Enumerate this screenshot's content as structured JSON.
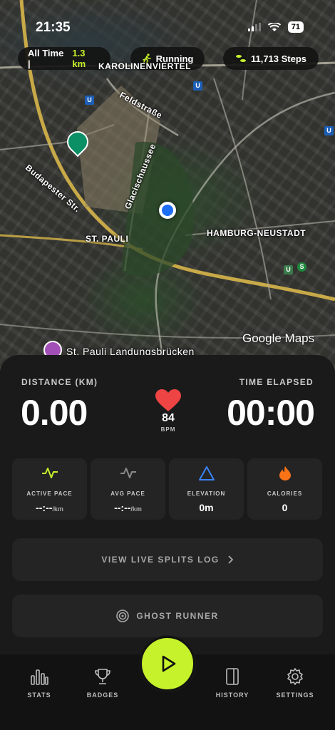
{
  "status_bar": {
    "time": "21:35",
    "battery": "71"
  },
  "top_pills": {
    "period_label": "All Time |",
    "period_distance": "1.3 km",
    "activity": "Running",
    "steps": "11,713 Steps"
  },
  "map": {
    "labels": {
      "karolinenviertel": "KAROLINENVIERTEL",
      "feldstrasse": "Feldstraße",
      "budapester": "Budapester Str.",
      "glacischaussee": "Glacischaussee",
      "st_pauli": "ST. PAULI",
      "hamburg_neustadt": "HAMBURG-NEUSTADT",
      "landungsbruecken": "St. Pauli Landungsbrücken",
      "transit_u": "U",
      "transit_s": "S"
    },
    "attribution": "Google Maps",
    "colors": {
      "user_dot": "#1e6df7",
      "road": "#d8b64a"
    }
  },
  "stats": {
    "distance_label": "DISTANCE (KM)",
    "distance_value": "0.00",
    "time_label": "TIME ELAPSED",
    "time_value": "00:00",
    "bpm_value": "84",
    "bpm_unit": "BPM"
  },
  "cards": [
    {
      "label": "ACTIVE PACE",
      "value": "--:--",
      "unit": "/km",
      "icon": "pulse-icon",
      "color": "#c6f22c"
    },
    {
      "label": "AVG PACE",
      "value": "--:--",
      "unit": "/km",
      "icon": "pulse-icon",
      "color": "#8a8a8a"
    },
    {
      "label": "ELEVATION",
      "value": "0m",
      "unit": "",
      "icon": "triangle-icon",
      "color": "#3b82f6"
    },
    {
      "label": "CALORIES",
      "value": "0",
      "unit": "",
      "icon": "flame-icon",
      "color": "#f97316"
    }
  ],
  "buttons": {
    "splits_log": "VIEW LIVE SPLITS LOG",
    "ghost_runner": "GHOST RUNNER"
  },
  "tabs": {
    "stats": "STATS",
    "badges": "BADGES",
    "history": "HISTORY",
    "settings": "SETTINGS"
  },
  "accent_color": "#c6f22c"
}
